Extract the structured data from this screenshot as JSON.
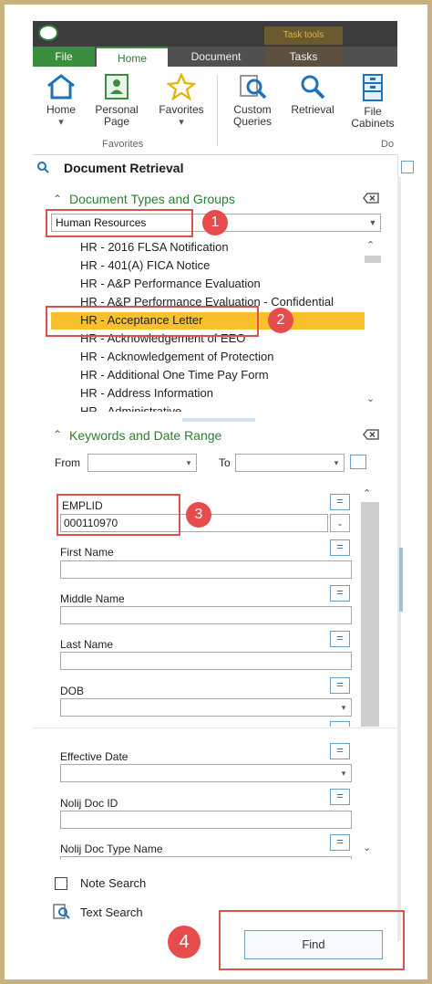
{
  "ribbon": {
    "tabs": [
      "File",
      "Home",
      "Document",
      "Tasks"
    ],
    "task_tools_label": "Task tools",
    "buttons": {
      "home": "Home",
      "personal_page": "Personal Page",
      "favorites": "Favorites",
      "custom_queries": "Custom Queries",
      "retrieval": "Retrieval",
      "file_cabinets": "File Cabinets"
    },
    "group_favorites": "Favorites",
    "group_do": "Do"
  },
  "panel": {
    "title": "Document Retrieval",
    "doc_types": {
      "title": "Document Types and Groups",
      "selected_group": "Human Resources",
      "items": [
        "HR - 2016 FLSA Notification",
        "HR - 401(A) FICA Notice",
        "HR - A&P Performance Evaluation",
        "HR - A&P Performance Evaluation - Confidential",
        "HR - Acceptance Letter",
        "HR - Acknowledgement of EEO",
        "HR - Acknowledgement of Protection",
        "HR - Additional One Time Pay Form",
        "HR - Address Information",
        "HR - Administrative..."
      ],
      "selected_index": 4
    },
    "keywords": {
      "title": "Keywords and Date Range",
      "from_label": "From",
      "to_label": "To",
      "fields": [
        {
          "label": "EMPLID",
          "value": "000110970"
        },
        {
          "label": "First Name",
          "value": ""
        },
        {
          "label": "Middle Name",
          "value": ""
        },
        {
          "label": "Last Name",
          "value": ""
        },
        {
          "label": "DOB",
          "value": ""
        },
        {
          "label": "Effective Date",
          "value": ""
        },
        {
          "label": "Nolij Doc ID",
          "value": ""
        },
        {
          "label": "Nolij Doc Type Name",
          "value": ""
        }
      ]
    },
    "options": {
      "note_search": "Note Search",
      "text_search": "Text Search"
    },
    "find_label": "Find"
  },
  "annotations": [
    "1",
    "2",
    "3",
    "4"
  ]
}
